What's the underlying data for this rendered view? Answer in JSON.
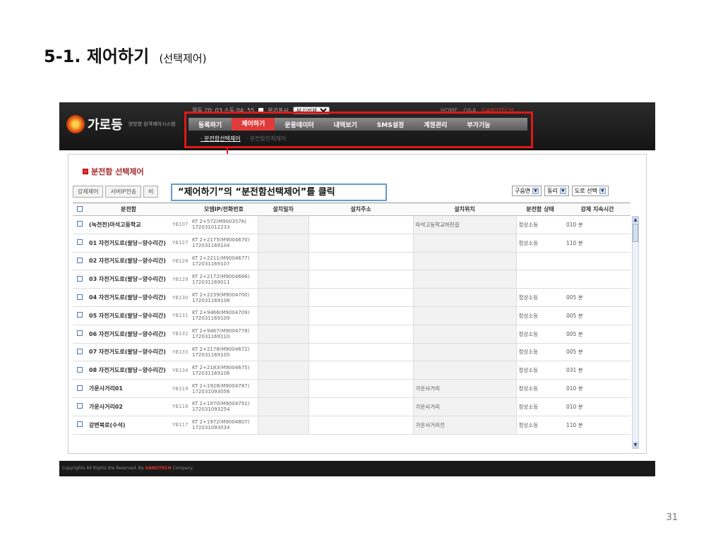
{
  "slide": {
    "title": "5-1. 제어하기",
    "subtitle": "(선택제어)",
    "page_number": "31"
  },
  "app": {
    "logo_text": "가로등",
    "logo_sub": "양방향 원격제어시스템",
    "clock_text": "점등 20: 03  소등 04: 55",
    "view_toggle_label": "분기표시",
    "view_select_value": "분기전체",
    "top_links": [
      "HOME",
      "Q&A",
      "GABOTECH"
    ],
    "menu": [
      {
        "label": "등록하기",
        "active": false
      },
      {
        "label": "제어하기",
        "active": true
      },
      {
        "label": "운용데이터",
        "active": false
      },
      {
        "label": "내역보기",
        "active": false
      },
      {
        "label": "SMS설정",
        "active": false
      },
      {
        "label": "계정관리",
        "active": false
      },
      {
        "label": "부가기능",
        "active": false
      }
    ],
    "submenu": [
      {
        "label": "· 분전함선택제어",
        "active": true
      },
      {
        "label": "· 분전함전체제어",
        "active": false
      }
    ],
    "footer": "Copyrights All Rights the Reserved.  By",
    "footer_brand": "GABOTECH",
    "footer_suffix": "Company."
  },
  "panel": {
    "title": "분전함 선택제어",
    "tools": [
      "강제제어",
      "서버IP전송",
      "비"
    ],
    "callout": "“제어하기”의 “분전함선택제어”를 클릭",
    "filters": [
      "구읍면",
      "동리",
      "도로 선택"
    ]
  },
  "table": {
    "headers": [
      "분전함",
      "",
      "모뎀IP/전화번호",
      "설치일자",
      "설치주소",
      "설치위치",
      "분전함 상태",
      "강제 지속시간"
    ],
    "rows": [
      {
        "name": "(녹천천)마석고등학교",
        "id": "YB107",
        "modem": "KT 2+572(M9003576)",
        "phone": "172031012233",
        "location": "마석고등학교하천길",
        "status": "정상소등",
        "duration": "010 분"
      },
      {
        "name": "01 자전거도로(팔당~양수리간)",
        "id": "YB127",
        "modem": "KT 2+2175(M9004670)",
        "phone": "172031169104",
        "location": "",
        "status": "정상소등",
        "duration": "110 분"
      },
      {
        "name": "02 자전거도로(팔당~양수리간)",
        "id": "YB128",
        "modem": "KT 2+2211(M9004677)",
        "phone": "172031169107",
        "location": "",
        "status": "",
        "duration": ""
      },
      {
        "name": "03 자전거도로(팔당~양수리간)",
        "id": "YB129",
        "modem": "KT 2+2172(M9004666)",
        "phone": "172031169011",
        "location": "",
        "status": "",
        "duration": ""
      },
      {
        "name": "04 자전거도로(팔당~양수리간)",
        "id": "YB130",
        "modem": "KT 2+2239(M9004700)",
        "phone": "172031169108",
        "location": "",
        "status": "정상소등",
        "duration": "005 분"
      },
      {
        "name": "05 자전거도로(팔당~양수리간)",
        "id": "YB131",
        "modem": "KT 2+9466(M9004709)",
        "phone": "172031169109",
        "location": "",
        "status": "정상소등",
        "duration": "005 분"
      },
      {
        "name": "06 자전거도로(팔당~양수리간)",
        "id": "YB132",
        "modem": "KT 2+9467(M9004778)",
        "phone": "172031169110",
        "location": "",
        "status": "정상소등",
        "duration": "005 분"
      },
      {
        "name": "07 자전거도로(팔당~양수리간)",
        "id": "YB133",
        "modem": "KT 2+2178(M9004672)",
        "phone": "172031169105",
        "location": "",
        "status": "정상소등",
        "duration": "005 분"
      },
      {
        "name": "08 자전거도로(팔당~양수리간)",
        "id": "YB134",
        "modem": "KT 2+2183(M9004675)",
        "phone": "172031169106",
        "location": "",
        "status": "정상소등",
        "duration": "031 분"
      },
      {
        "name": "가운사거리01",
        "id": "YB119",
        "modem": "KT 2+1928(M9004787)",
        "phone": "172031093056",
        "location": "가운사거리",
        "status": "정상소등",
        "duration": "010 분"
      },
      {
        "name": "가운사거리02",
        "id": "YB118",
        "modem": "KT 2+1970(M9004791)",
        "phone": "172031093254",
        "location": "가운사거리",
        "status": "정상소등",
        "duration": "010 분"
      },
      {
        "name": "강변북로(수석)",
        "id": "YB117",
        "modem": "KT 2+1972(M9004807)",
        "phone": "172031093034",
        "location": "가운사거리전",
        "status": "정상소등",
        "duration": "110 분"
      }
    ]
  },
  "colors": {
    "highlight_red": "#e01818",
    "callout_border": "#6699cc",
    "menu_active": "#e03b3b"
  }
}
